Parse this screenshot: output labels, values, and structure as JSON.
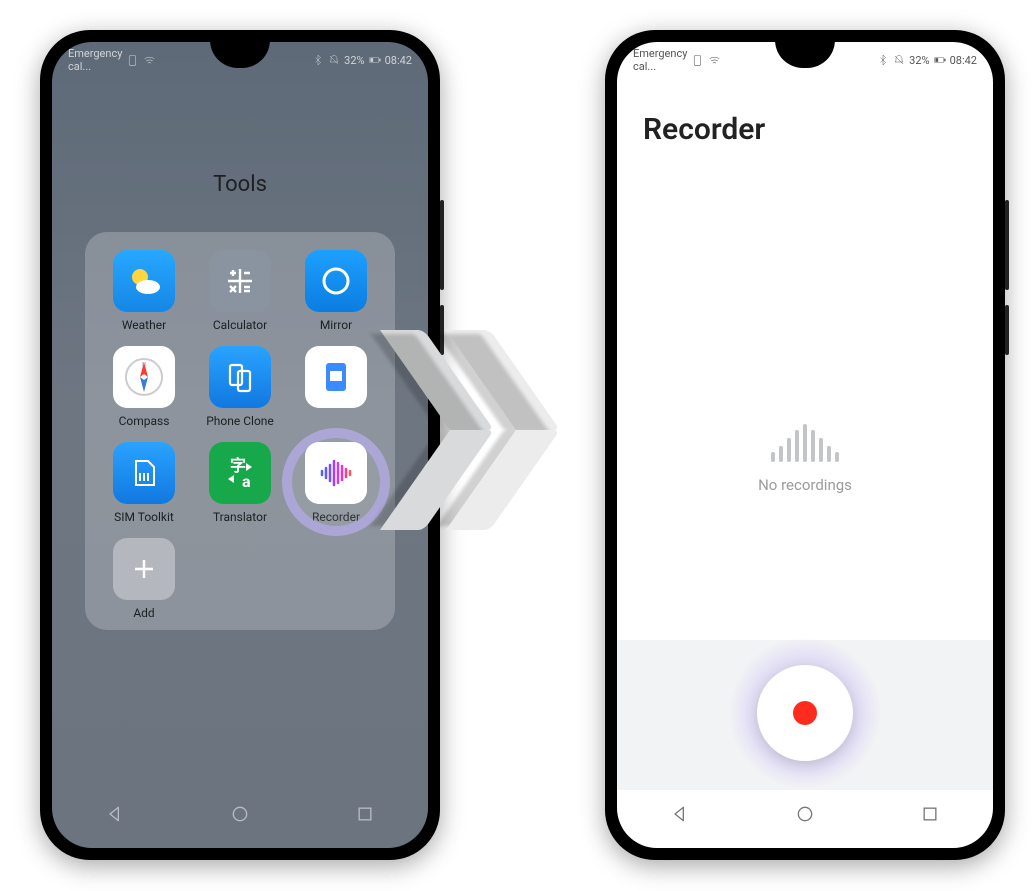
{
  "status": {
    "carrier": "Emergency cal...",
    "battery_pct": "32%",
    "time": "08:42"
  },
  "home": {
    "folder_title": "Tools",
    "apps": [
      {
        "label": "Weather"
      },
      {
        "label": "Calculator"
      },
      {
        "label": "Mirror"
      },
      {
        "label": "Compass"
      },
      {
        "label": "Phone Clone"
      },
      {
        "label": ""
      },
      {
        "label": "SIM Toolkit"
      },
      {
        "label": "Translator"
      },
      {
        "label": "Recorder"
      },
      {
        "label": "Add"
      }
    ]
  },
  "recorder": {
    "title": "Recorder",
    "empty_text": "No recordings"
  }
}
